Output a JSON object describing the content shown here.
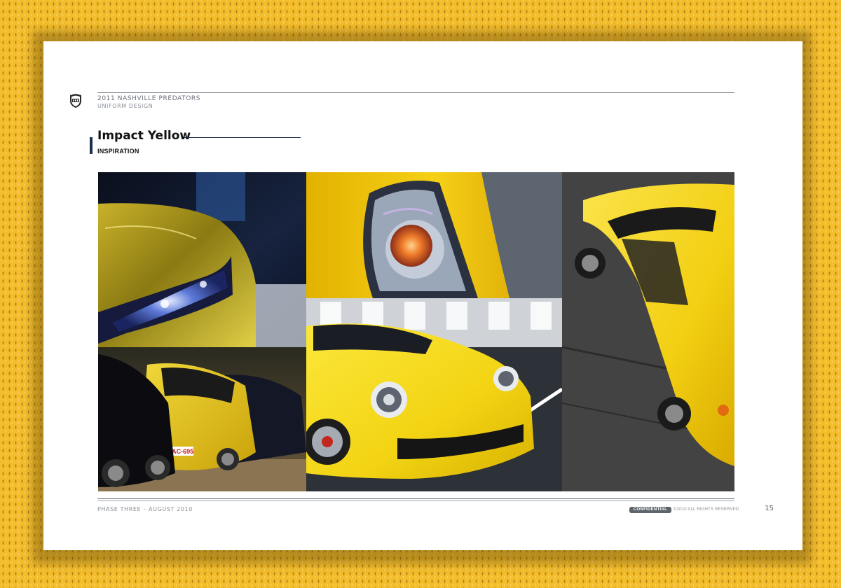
{
  "header": {
    "title": "2011 NASHVILLE PREDATORS",
    "subtitle": "UNIFORM DESIGN"
  },
  "section": {
    "title": "Impact Yellow",
    "subtitle": "INSPIRATION"
  },
  "photos": {
    "tile1_icon": "yellow-concept-car-headlight-photo",
    "tile2_icon": "yellow-car-taillight-closeup-photo",
    "tile3_icon": "yellow-lamborghini-overhead-photo",
    "tile4_icon": "corvette-lineup-photo",
    "tile4_plate": "YAC-695",
    "tile5_icon": "yellow-porsche-911-photo"
  },
  "footer": {
    "phase": "PHASE THREE – AUGUST 2010",
    "confidential": "CONFIDENTIAL",
    "copyright": "©2010 ALL RIGHTS RESERVED",
    "page_number": "15"
  },
  "colors": {
    "background": "#f3bd2c",
    "accent_navy": "#1e2f4d",
    "impact_yellow": "#f2d500"
  }
}
